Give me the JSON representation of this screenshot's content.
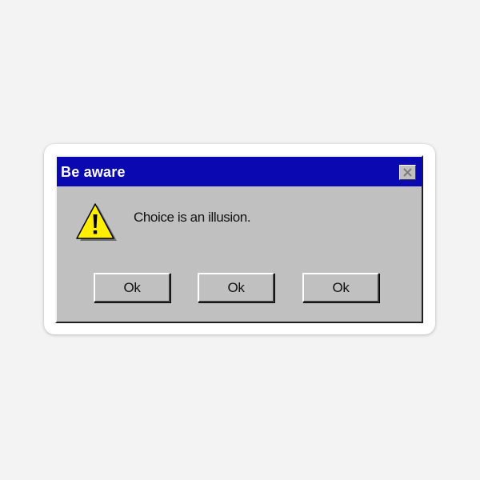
{
  "dialog": {
    "title": "Be aware",
    "message": "Choice is an illusion.",
    "icon": "warning-icon",
    "close_icon": "close-icon",
    "buttons": [
      {
        "label": "Ok"
      },
      {
        "label": "Ok"
      },
      {
        "label": "Ok"
      }
    ]
  },
  "colors": {
    "titlebar": "#0a08b0",
    "dialog_face": "#c0c0c0",
    "warning_fill": "#ffee00",
    "background": "#f3f3f3"
  }
}
